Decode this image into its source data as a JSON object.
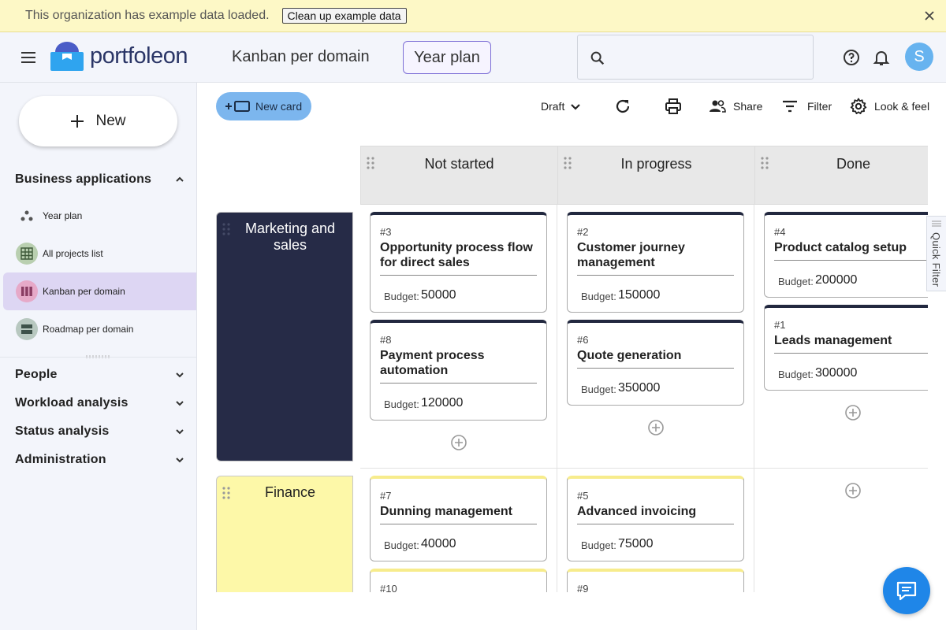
{
  "banner": {
    "text": "This organization has example data loaded.",
    "button_label": "Clean up example data"
  },
  "header": {
    "logo_text": "portfoleon",
    "view_title": "Kanban per domain",
    "view_button": "Year plan",
    "search_placeholder": "",
    "avatar_initial": "S"
  },
  "sidebar": {
    "new_label": "New",
    "sections": [
      {
        "label": "Business applications",
        "expanded": true
      },
      {
        "label": "People",
        "expanded": false
      },
      {
        "label": "Workload analysis",
        "expanded": false
      },
      {
        "label": "Status analysis",
        "expanded": false
      },
      {
        "label": "Administration",
        "expanded": false
      }
    ],
    "items": [
      {
        "label": "Year plan",
        "icon": "timeline-icon"
      },
      {
        "label": "All projects list",
        "icon": "grid-icon"
      },
      {
        "label": "Kanban per domain",
        "icon": "kanban-icon",
        "active": true
      },
      {
        "label": "Roadmap per domain",
        "icon": "roadmap-icon"
      }
    ]
  },
  "toolbar": {
    "new_card": "New card",
    "draft": "Draft",
    "share": "Share",
    "filter": "Filter",
    "look_feel": "Look & feel"
  },
  "board": {
    "columns": [
      "Not started",
      "In progress",
      "Done"
    ],
    "rows": [
      {
        "name": "Marketing and sales",
        "color": "#262b47",
        "cards": [
          {
            "num": "#3",
            "title": "Opportunity process flow for direct sales",
            "budget_label": "Budget:",
            "budget": "50000"
          },
          {
            "num": "#8",
            "title": "Payment process automation",
            "budget_label": "Budget:",
            "budget": "120000"
          },
          {
            "num": "#2",
            "title": "Customer journey management",
            "budget_label": "Budget:",
            "budget": "150000"
          },
          {
            "num": "#6",
            "title": "Quote generation",
            "budget_label": "Budget:",
            "budget": "350000"
          },
          {
            "num": "#4",
            "title": "Product catalog setup",
            "budget_label": "Budget:",
            "budget": "200000"
          },
          {
            "num": "#1",
            "title": "Leads management",
            "budget_label": "Budget:",
            "budget": "300000"
          }
        ]
      },
      {
        "name": "Finance",
        "color": "#fdf8a8",
        "cards": [
          {
            "num": "#7",
            "title": "Dunning management",
            "budget_label": "Budget:",
            "budget": "40000"
          },
          {
            "num": "#10",
            "title": "",
            "budget_label": "",
            "budget": ""
          },
          {
            "num": "#5",
            "title": "Advanced invoicing",
            "budget_label": "Budget:",
            "budget": "75000"
          },
          {
            "num": "#9",
            "title": "",
            "budget_label": "",
            "budget": ""
          }
        ]
      }
    ]
  },
  "quick_filter": "Quick Filter"
}
